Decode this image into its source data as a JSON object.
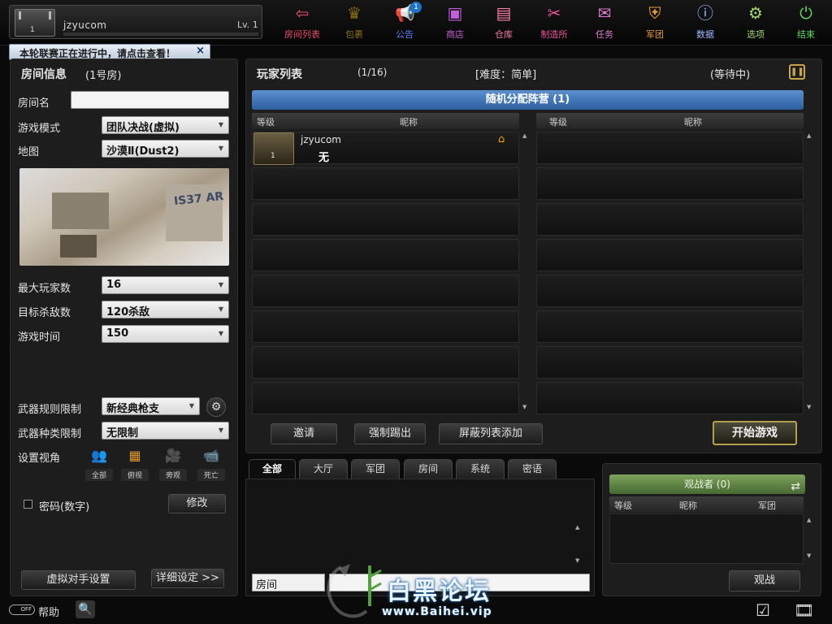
{
  "profile": {
    "username": "jzyucom",
    "level": "Lv. 1",
    "rank": "1"
  },
  "notice": {
    "text": "本轮联赛正在进行中，请点击查看！",
    "close": "×"
  },
  "nav": [
    {
      "label": "房间列表",
      "icon": "back-arrow-icon",
      "glyph": "⇦",
      "color": "#e84a6e"
    },
    {
      "label": "包裹",
      "icon": "crown-icon",
      "glyph": "♛",
      "color": "#8b6d12"
    },
    {
      "label": "公告",
      "icon": "megaphone-icon",
      "glyph": "📢",
      "color": "#5a7dff",
      "badge": "1"
    },
    {
      "label": "商店",
      "icon": "shop-icon",
      "glyph": "▣",
      "color": "#c55ed8"
    },
    {
      "label": "仓库",
      "icon": "warehouse-icon",
      "glyph": "▤",
      "color": "#ff7ea8"
    },
    {
      "label": "制造所",
      "icon": "craft-icon",
      "glyph": "✂",
      "color": "#e8559a"
    },
    {
      "label": "任务",
      "icon": "mission-icon",
      "glyph": "✉",
      "color": "#e07bd0"
    },
    {
      "label": "军团",
      "icon": "clan-icon",
      "glyph": "⛨",
      "color": "#e89a3d"
    },
    {
      "label": "数据",
      "icon": "info-icon",
      "glyph": "ⓘ",
      "color": "#9ab8ff"
    },
    {
      "label": "选项",
      "icon": "gear-icon",
      "glyph": "⚙",
      "color": "#9ed86d"
    },
    {
      "label": "结束",
      "icon": "power-icon",
      "glyph": "⏻",
      "color": "#5ed85e"
    }
  ],
  "room": {
    "title": "房间信息",
    "number": "(1号房)",
    "name_label": "房间名",
    "name_value": "",
    "mode_label": "游戏模式",
    "mode_value": "团队决战(虚拟)",
    "map_label": "地图",
    "map_value": "沙漠Ⅱ(Dust2)",
    "map_graffiti": "IS37 AR",
    "max_players_label": "最大玩家数",
    "max_players_value": "16",
    "target_kills_label": "目标杀敌数",
    "target_kills_value": "120杀敌",
    "game_time_label": "游戏时间",
    "game_time_value": "150",
    "weapon_rule_label": "武器规则限制",
    "weapon_rule_value": "新经典枪支",
    "weapon_type_label": "武器种类限制",
    "weapon_type_value": "无限制",
    "view_label": "设置视角",
    "views": [
      "全部",
      "俯视",
      "旁观",
      "死亡"
    ],
    "password_label": "密码(数字)",
    "modify_button": "修改",
    "bot_button": "虚拟对手设置",
    "detail_button": "详细设定 >>"
  },
  "players": {
    "title": "玩家列表",
    "count": "(1/16)",
    "difficulty": "[难度：简单]",
    "status": "(等待中)",
    "team_bar": "随机分配阵营 (1)",
    "col_level": "等级",
    "col_name": "昵称",
    "slots": [
      {
        "name": "jzyucom",
        "clan": "无",
        "rank": "1",
        "host": true
      }
    ],
    "invite_button": "邀请",
    "kick_button": "强制踢出",
    "block_button": "屏蔽列表添加",
    "start_button": "开始游戏"
  },
  "chat": {
    "tabs": [
      "全部",
      "大厅",
      "军团",
      "房间",
      "系统",
      "密语"
    ],
    "channel": "房间",
    "input_value": ""
  },
  "spectators": {
    "title": "观战者 (0)",
    "col_level": "等级",
    "col_name": "昵称",
    "col_clan": "军团",
    "watch_button": "观战"
  },
  "bottom": {
    "toggle": "OFF",
    "help": "帮助"
  },
  "watermark": {
    "title": "白黑论坛",
    "url": "www.Baihei.vip"
  }
}
